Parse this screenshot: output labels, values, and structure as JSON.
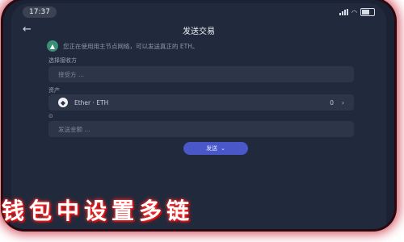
{
  "status": {
    "time": "17:37"
  },
  "nav": {
    "title": "发送交易"
  },
  "notice": {
    "text": "您正在使用用主节点网络，可以发送真正的 ETH。"
  },
  "form": {
    "network_label": "选择接收方",
    "network_placeholder": "接受方 ...",
    "asset_label": "资产",
    "asset_name": "Ether · ETH",
    "asset_balance": "0",
    "amount_placeholder": "发送金额 ..."
  },
  "send_button": {
    "label": "发送"
  },
  "overlay": {
    "text": "钱包中设置多链"
  }
}
